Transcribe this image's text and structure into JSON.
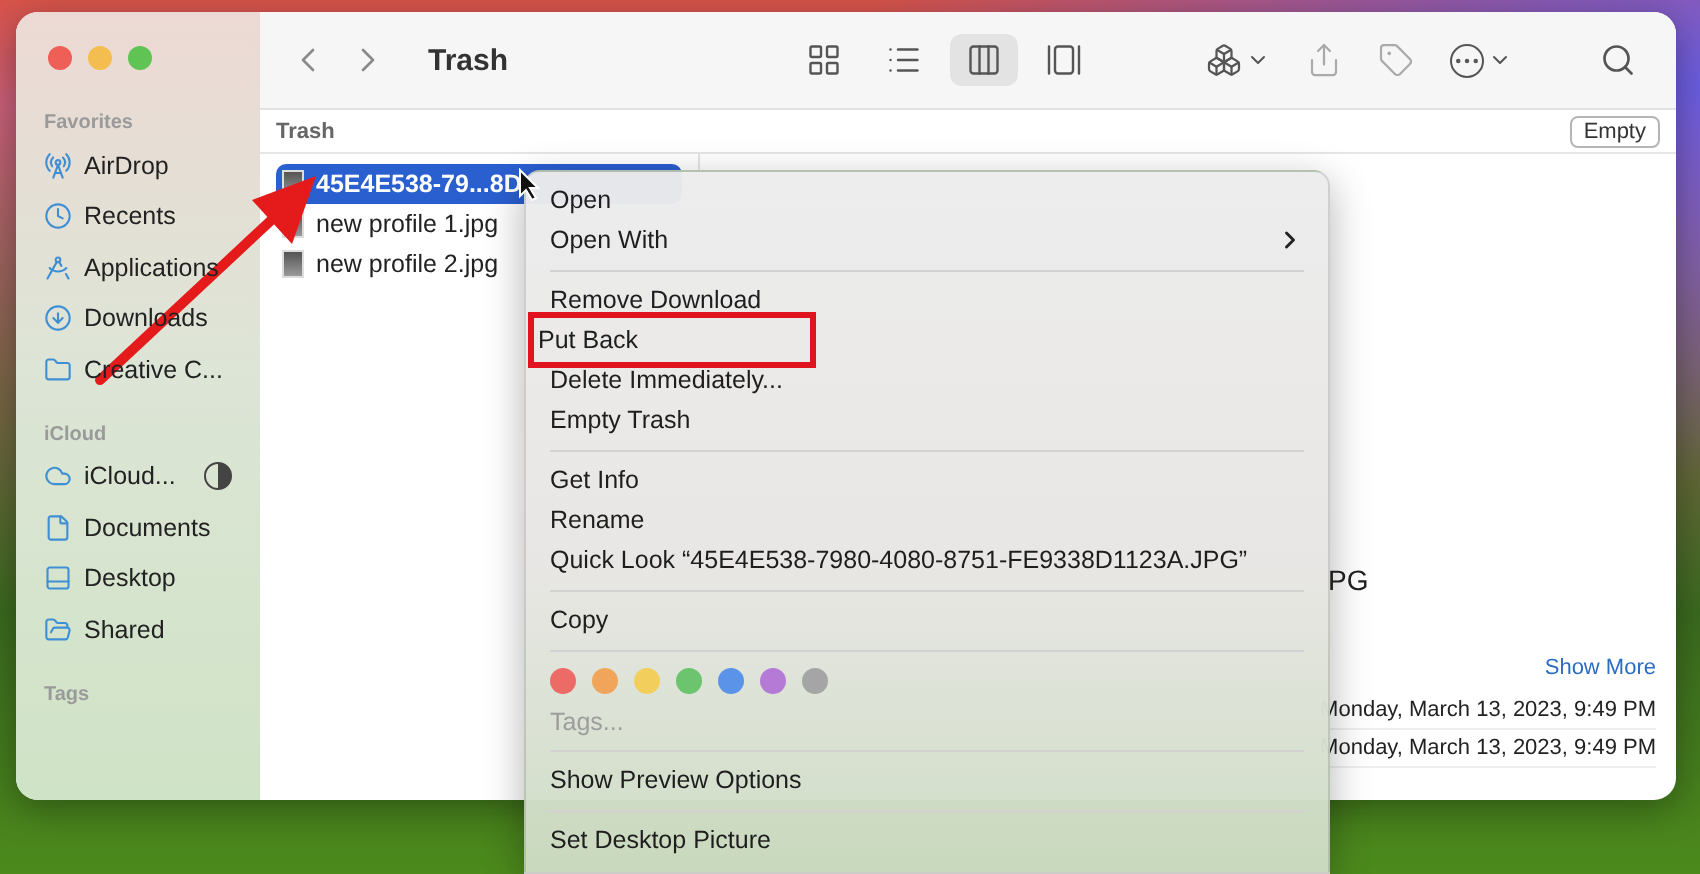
{
  "window": {
    "title": "Trash"
  },
  "toolbar": {
    "views": [
      {
        "selected": false
      },
      {
        "selected": false
      },
      {
        "selected": true
      },
      {
        "selected": false
      }
    ]
  },
  "sidebar": {
    "sections": [
      {
        "heading": "Favorites",
        "items": [
          {
            "label": "AirDrop"
          },
          {
            "label": "Recents"
          },
          {
            "label": "Applications"
          },
          {
            "label": "Downloads"
          },
          {
            "label": "Creative C..."
          }
        ]
      },
      {
        "heading": "iCloud",
        "items": [
          {
            "label": "iCloud..."
          },
          {
            "label": "Documents"
          },
          {
            "label": "Desktop"
          },
          {
            "label": "Shared"
          }
        ]
      },
      {
        "heading": "Tags"
      }
    ]
  },
  "path_bar": {
    "title": "Trash",
    "button": "Empty"
  },
  "files": [
    {
      "name": "45E4E538-79...8D",
      "selected": true
    },
    {
      "name": "new profile 1.jpg",
      "selected": false
    },
    {
      "name": "new profile 2.jpg",
      "selected": false
    }
  ],
  "preview": {
    "name_tail": "PG",
    "show_more": "Show More",
    "dates": [
      "Monday, March 13, 2023, 9:49 PM",
      "Monday, March 13, 2023, 9:49 PM"
    ]
  },
  "context_menu": {
    "groups": [
      {
        "kind": "items",
        "items": [
          {
            "label": "Open",
            "submenu": false,
            "outlined": false
          },
          {
            "label": "Open With",
            "submenu": true,
            "outlined": false
          }
        ]
      },
      {
        "kind": "items",
        "items": [
          {
            "label": "Remove Download",
            "submenu": false,
            "outlined": false
          },
          {
            "label": "Put Back",
            "submenu": false,
            "outlined": true
          },
          {
            "label": "Delete Immediately...",
            "submenu": false,
            "outlined": false
          },
          {
            "label": "Empty Trash",
            "submenu": false,
            "outlined": false
          }
        ]
      },
      {
        "kind": "items",
        "items": [
          {
            "label": "Get Info",
            "submenu": false,
            "outlined": false
          },
          {
            "label": "Rename",
            "submenu": false,
            "outlined": false
          },
          {
            "label": "Quick Look “45E4E538-7980-4080-8751-FE9338D1123A.JPG”",
            "submenu": false,
            "outlined": false
          }
        ]
      },
      {
        "kind": "items",
        "items": [
          {
            "label": "Copy",
            "submenu": false,
            "outlined": false
          }
        ]
      },
      {
        "kind": "tags",
        "tags": [
          {
            "color": "#ec6b66"
          },
          {
            "color": "#f0a55a"
          },
          {
            "color": "#f2cf5c"
          },
          {
            "color": "#6cc46e"
          },
          {
            "color": "#5b93e8"
          },
          {
            "color": "#b57ad6"
          },
          {
            "color": "#a5a5a5"
          }
        ],
        "label": "Tags..."
      },
      {
        "kind": "items",
        "items": [
          {
            "label": "Show Preview Options",
            "submenu": false,
            "outlined": false
          }
        ]
      },
      {
        "kind": "items",
        "items": [
          {
            "label": "Set Desktop Picture",
            "submenu": false,
            "outlined": false
          }
        ]
      }
    ]
  }
}
